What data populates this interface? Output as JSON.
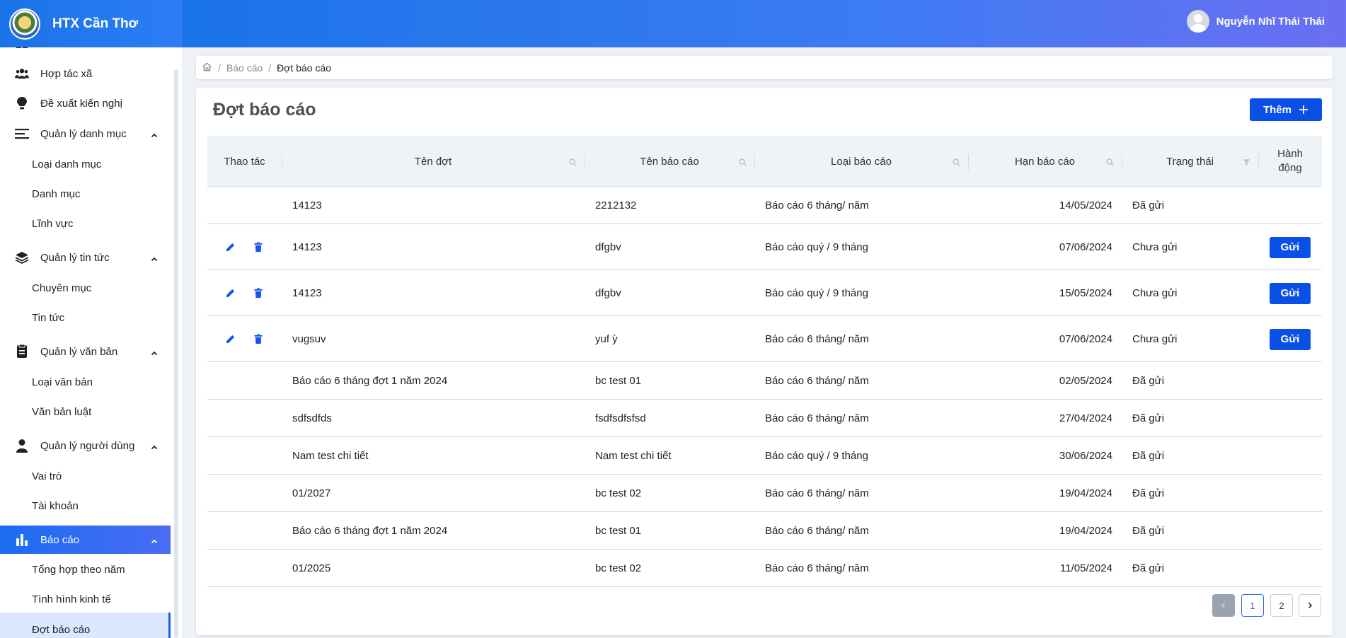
{
  "brand": {
    "name": "HTX Cần Thơ"
  },
  "user": {
    "name": "Nguyễn Nhĩ Thái Thái"
  },
  "sidebar": {
    "items": [
      {
        "label": "Hợp tác xã",
        "icon": "users-icon"
      },
      {
        "label": "Đề xuất kiến nghị",
        "icon": "lightbulb-icon"
      },
      {
        "label": "Quản lý danh mục",
        "icon": "list-icon",
        "children": [
          "Loại danh mục",
          "Danh mục",
          "Lĩnh vực"
        ]
      },
      {
        "label": "Quản lý tin tức",
        "icon": "layers-icon",
        "children": [
          "Chuyên mục",
          "Tin tức"
        ]
      },
      {
        "label": "Quản lý văn bản",
        "icon": "document-icon",
        "children": [
          "Loại văn bản",
          "Văn bản luật"
        ]
      },
      {
        "label": "Quản lý người dùng",
        "icon": "person-icon",
        "children": [
          "Vai trò",
          "Tài khoản"
        ]
      },
      {
        "label": "Báo cáo",
        "icon": "bar-chart-icon",
        "children": [
          "Tổng hợp theo năm",
          "Tình hình kinh tế",
          "Đợt báo cáo"
        ]
      }
    ]
  },
  "breadcrumb": {
    "items": [
      "Báo cáo",
      "Đợt báo cáo"
    ]
  },
  "page": {
    "title": "Đợt báo cáo",
    "add_label": "Thêm"
  },
  "table": {
    "columns": [
      "Thao tác",
      "Tên đợt",
      "Tên báo cáo",
      "Loại báo cáo",
      "Hạn báo cáo",
      "Trạng thái",
      "Hành động"
    ],
    "send_label": "Gửi",
    "rows": [
      {
        "ten_dot": "14123",
        "ten_bao_cao": "2212132",
        "loai": "Báo cáo 6 tháng/ năm",
        "han": "14/05/2024",
        "trang_thai": "Đã gửi",
        "editable": false
      },
      {
        "ten_dot": "14123",
        "ten_bao_cao": "dfgbv",
        "loai": "Báo cáo quý / 9 tháng",
        "han": "07/06/2024",
        "trang_thai": "Chưa gửi",
        "editable": true
      },
      {
        "ten_dot": "14123",
        "ten_bao_cao": "dfgbv",
        "loai": "Báo cáo quý / 9 tháng",
        "han": "15/05/2024",
        "trang_thai": "Chưa gửi",
        "editable": true
      },
      {
        "ten_dot": "vugsuv",
        "ten_bao_cao": "yuf ỳ",
        "loai": "Báo cáo 6 tháng/ năm",
        "han": "07/06/2024",
        "trang_thai": "Chưa gửi",
        "editable": true
      },
      {
        "ten_dot": "Báo cáo 6 tháng đợt 1 năm 2024",
        "ten_bao_cao": "bc test 01",
        "loai": "Báo cáo 6 tháng/ năm",
        "han": "02/05/2024",
        "trang_thai": "Đã gửi",
        "editable": false
      },
      {
        "ten_dot": "sdfsdfds",
        "ten_bao_cao": "fsdfsdfsfsd",
        "loai": "Báo cáo 6 tháng/ năm",
        "han": "27/04/2024",
        "trang_thai": "Đã gửi",
        "editable": false
      },
      {
        "ten_dot": "Nam test chi tiết",
        "ten_bao_cao": "Nam test chi tiết",
        "loai": "Báo cáo quý / 9 tháng",
        "han": "30/06/2024",
        "trang_thai": "Đã gửi",
        "editable": false
      },
      {
        "ten_dot": "01/2027",
        "ten_bao_cao": "bc test 02",
        "loai": "Báo cáo 6 tháng/ năm",
        "han": "19/04/2024",
        "trang_thai": "Đã gửi",
        "editable": false
      },
      {
        "ten_dot": "Báo cáo 6 tháng đợt 1 năm 2024",
        "ten_bao_cao": "bc test 01",
        "loai": "Báo cáo 6 tháng/ năm",
        "han": "19/04/2024",
        "trang_thai": "Đã gửi",
        "editable": false
      },
      {
        "ten_dot": "01/2025",
        "ten_bao_cao": "bc test 02",
        "loai": "Báo cáo 6 tháng/ năm",
        "han": "11/05/2024",
        "trang_thai": "Đã gửi",
        "editable": false
      }
    ]
  },
  "pagination": {
    "pages": [
      "1",
      "2"
    ],
    "current": "1"
  },
  "colors": {
    "primary": "#0a4fe6",
    "header_start": "#1a73e8",
    "header_end": "#6b6ff2",
    "active_sub_bg": "#dbe8ff"
  }
}
